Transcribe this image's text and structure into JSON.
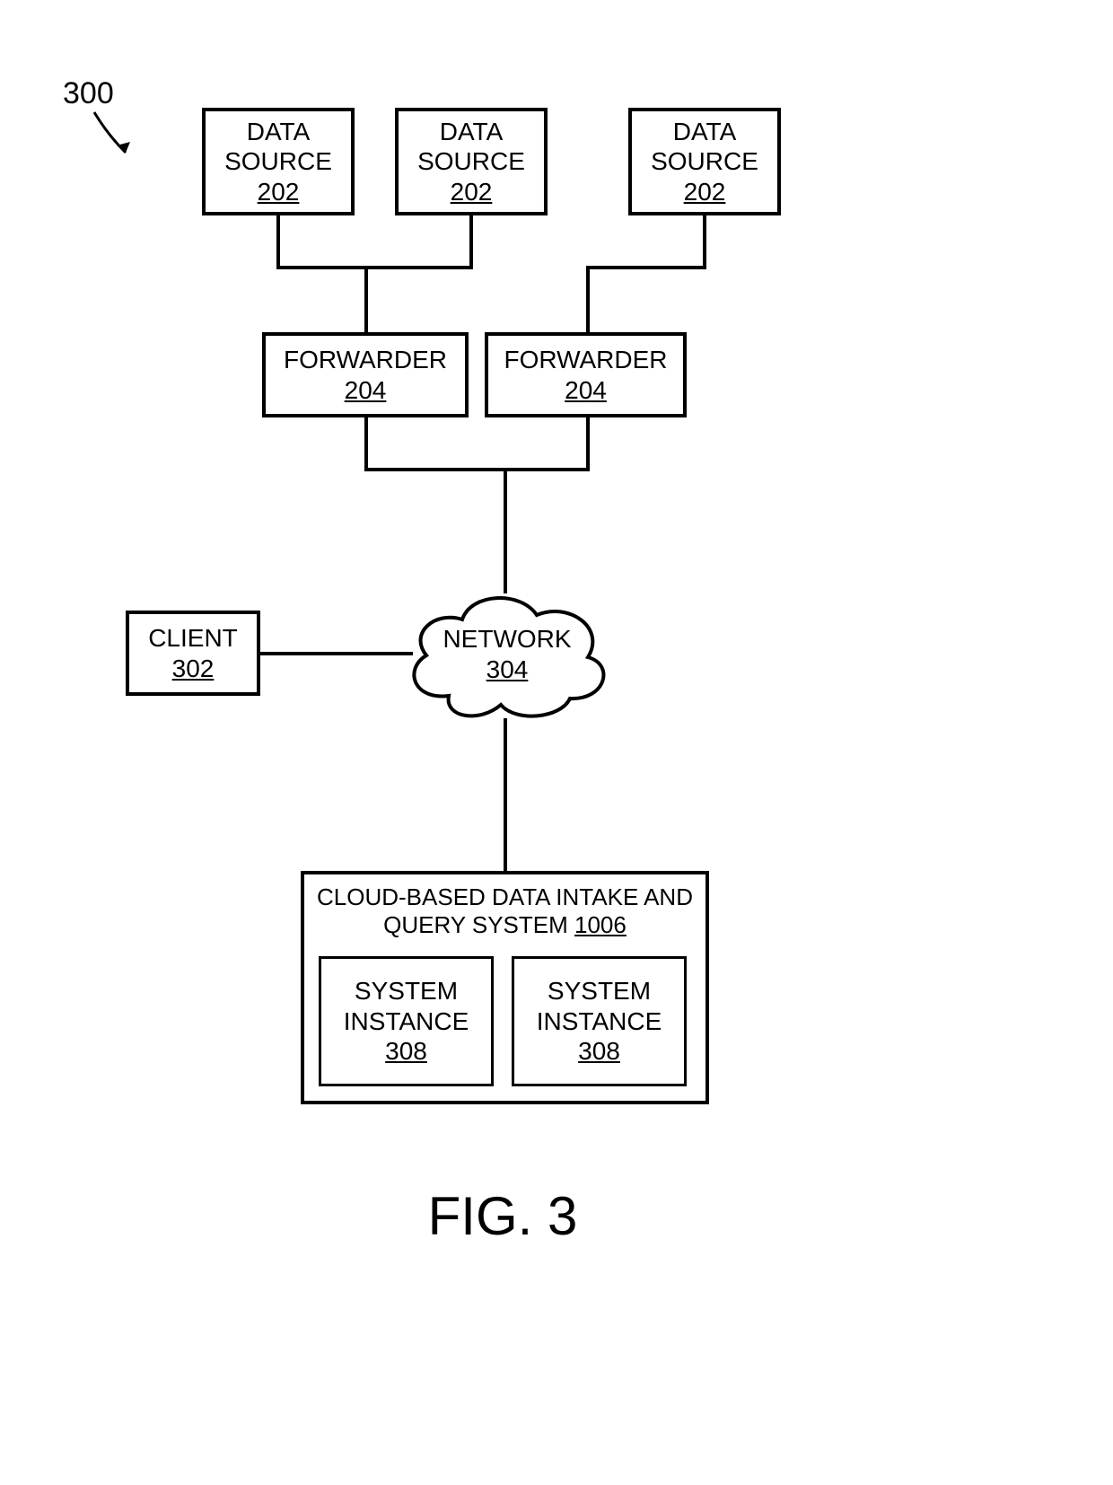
{
  "figure": {
    "number": "300",
    "caption": "FIG. 3"
  },
  "blocks": {
    "ds1": {
      "label": "DATA SOURCE",
      "ref": "202"
    },
    "ds2": {
      "label": "DATA SOURCE",
      "ref": "202"
    },
    "ds3": {
      "label": "DATA SOURCE",
      "ref": "202"
    },
    "fw1": {
      "label": "FORWARDER",
      "ref": "204"
    },
    "fw2": {
      "label": "FORWARDER",
      "ref": "204"
    },
    "client": {
      "label": "CLIENT",
      "ref": "302"
    },
    "network": {
      "label": "NETWORK",
      "ref": "304"
    },
    "cloud_system": {
      "label": "CLOUD-BASED DATA INTAKE AND QUERY SYSTEM",
      "ref": "1006"
    },
    "si1": {
      "label": "SYSTEM INSTANCE",
      "ref": "308"
    },
    "si2": {
      "label": "SYSTEM INSTANCE",
      "ref": "308"
    }
  }
}
